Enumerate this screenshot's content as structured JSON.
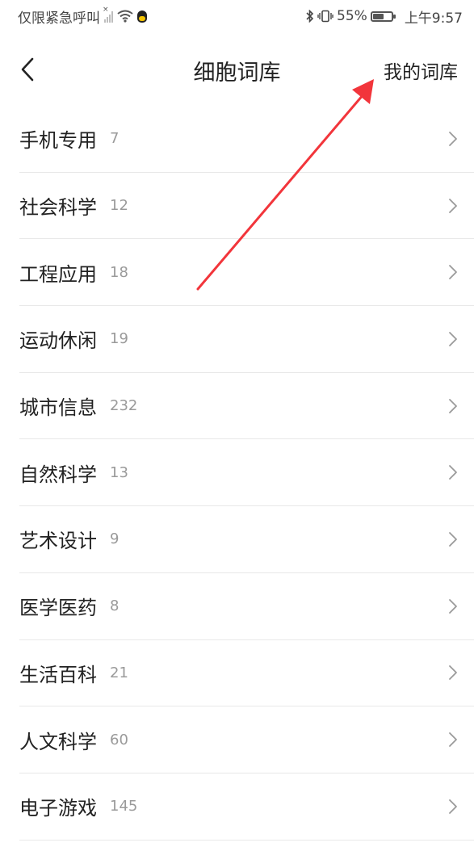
{
  "status_bar": {
    "carrier": "仅限紧急呼叫",
    "battery_percent": "55%",
    "time": "上午9:57",
    "icons": [
      "signal-icon",
      "wifi-icon",
      "qq-penguin-icon",
      "bluetooth-icon",
      "vibrate-icon",
      "battery-icon"
    ]
  },
  "header": {
    "back_icon": "chevron-left-icon",
    "title": "细胞词库",
    "my_library": "我的词库"
  },
  "categories": [
    {
      "name": "手机专用",
      "count": "7"
    },
    {
      "name": "社会科学",
      "count": "12"
    },
    {
      "name": "工程应用",
      "count": "18"
    },
    {
      "name": "运动休闲",
      "count": "19"
    },
    {
      "name": "城市信息",
      "count": "232"
    },
    {
      "name": "自然科学",
      "count": "13"
    },
    {
      "name": "艺术设计",
      "count": "9"
    },
    {
      "name": "医学医药",
      "count": "8"
    },
    {
      "name": "生活百科",
      "count": "21"
    },
    {
      "name": "人文科学",
      "count": "60"
    },
    {
      "name": "电子游戏",
      "count": "145"
    }
  ],
  "colors": {
    "annotation_arrow": "#f2353b",
    "divider": "#e8e8e8",
    "count_text": "#9a9a9a"
  }
}
